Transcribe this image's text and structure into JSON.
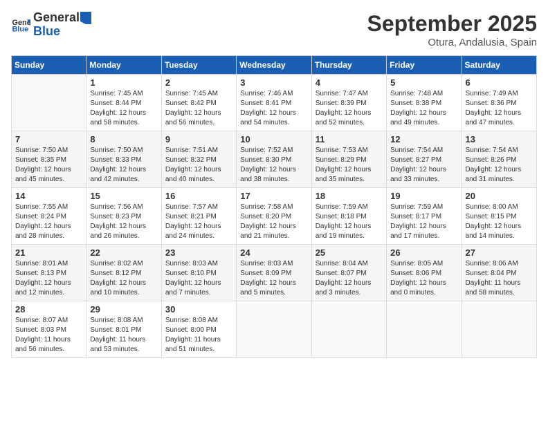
{
  "header": {
    "logo_line1": "General",
    "logo_line2": "Blue",
    "month": "September 2025",
    "location": "Otura, Andalusia, Spain"
  },
  "weekdays": [
    "Sunday",
    "Monday",
    "Tuesday",
    "Wednesday",
    "Thursday",
    "Friday",
    "Saturday"
  ],
  "weeks": [
    [
      {
        "day": "",
        "info": ""
      },
      {
        "day": "1",
        "info": "Sunrise: 7:45 AM\nSunset: 8:44 PM\nDaylight: 12 hours\nand 58 minutes."
      },
      {
        "day": "2",
        "info": "Sunrise: 7:45 AM\nSunset: 8:42 PM\nDaylight: 12 hours\nand 56 minutes."
      },
      {
        "day": "3",
        "info": "Sunrise: 7:46 AM\nSunset: 8:41 PM\nDaylight: 12 hours\nand 54 minutes."
      },
      {
        "day": "4",
        "info": "Sunrise: 7:47 AM\nSunset: 8:39 PM\nDaylight: 12 hours\nand 52 minutes."
      },
      {
        "day": "5",
        "info": "Sunrise: 7:48 AM\nSunset: 8:38 PM\nDaylight: 12 hours\nand 49 minutes."
      },
      {
        "day": "6",
        "info": "Sunrise: 7:49 AM\nSunset: 8:36 PM\nDaylight: 12 hours\nand 47 minutes."
      }
    ],
    [
      {
        "day": "7",
        "info": "Sunrise: 7:50 AM\nSunset: 8:35 PM\nDaylight: 12 hours\nand 45 minutes."
      },
      {
        "day": "8",
        "info": "Sunrise: 7:50 AM\nSunset: 8:33 PM\nDaylight: 12 hours\nand 42 minutes."
      },
      {
        "day": "9",
        "info": "Sunrise: 7:51 AM\nSunset: 8:32 PM\nDaylight: 12 hours\nand 40 minutes."
      },
      {
        "day": "10",
        "info": "Sunrise: 7:52 AM\nSunset: 8:30 PM\nDaylight: 12 hours\nand 38 minutes."
      },
      {
        "day": "11",
        "info": "Sunrise: 7:53 AM\nSunset: 8:29 PM\nDaylight: 12 hours\nand 35 minutes."
      },
      {
        "day": "12",
        "info": "Sunrise: 7:54 AM\nSunset: 8:27 PM\nDaylight: 12 hours\nand 33 minutes."
      },
      {
        "day": "13",
        "info": "Sunrise: 7:54 AM\nSunset: 8:26 PM\nDaylight: 12 hours\nand 31 minutes."
      }
    ],
    [
      {
        "day": "14",
        "info": "Sunrise: 7:55 AM\nSunset: 8:24 PM\nDaylight: 12 hours\nand 28 minutes."
      },
      {
        "day": "15",
        "info": "Sunrise: 7:56 AM\nSunset: 8:23 PM\nDaylight: 12 hours\nand 26 minutes."
      },
      {
        "day": "16",
        "info": "Sunrise: 7:57 AM\nSunset: 8:21 PM\nDaylight: 12 hours\nand 24 minutes."
      },
      {
        "day": "17",
        "info": "Sunrise: 7:58 AM\nSunset: 8:20 PM\nDaylight: 12 hours\nand 21 minutes."
      },
      {
        "day": "18",
        "info": "Sunrise: 7:59 AM\nSunset: 8:18 PM\nDaylight: 12 hours\nand 19 minutes."
      },
      {
        "day": "19",
        "info": "Sunrise: 7:59 AM\nSunset: 8:17 PM\nDaylight: 12 hours\nand 17 minutes."
      },
      {
        "day": "20",
        "info": "Sunrise: 8:00 AM\nSunset: 8:15 PM\nDaylight: 12 hours\nand 14 minutes."
      }
    ],
    [
      {
        "day": "21",
        "info": "Sunrise: 8:01 AM\nSunset: 8:13 PM\nDaylight: 12 hours\nand 12 minutes."
      },
      {
        "day": "22",
        "info": "Sunrise: 8:02 AM\nSunset: 8:12 PM\nDaylight: 12 hours\nand 10 minutes."
      },
      {
        "day": "23",
        "info": "Sunrise: 8:03 AM\nSunset: 8:10 PM\nDaylight: 12 hours\nand 7 minutes."
      },
      {
        "day": "24",
        "info": "Sunrise: 8:03 AM\nSunset: 8:09 PM\nDaylight: 12 hours\nand 5 minutes."
      },
      {
        "day": "25",
        "info": "Sunrise: 8:04 AM\nSunset: 8:07 PM\nDaylight: 12 hours\nand 3 minutes."
      },
      {
        "day": "26",
        "info": "Sunrise: 8:05 AM\nSunset: 8:06 PM\nDaylight: 12 hours\nand 0 minutes."
      },
      {
        "day": "27",
        "info": "Sunrise: 8:06 AM\nSunset: 8:04 PM\nDaylight: 11 hours\nand 58 minutes."
      }
    ],
    [
      {
        "day": "28",
        "info": "Sunrise: 8:07 AM\nSunset: 8:03 PM\nDaylight: 11 hours\nand 56 minutes."
      },
      {
        "day": "29",
        "info": "Sunrise: 8:08 AM\nSunset: 8:01 PM\nDaylight: 11 hours\nand 53 minutes."
      },
      {
        "day": "30",
        "info": "Sunrise: 8:08 AM\nSunset: 8:00 PM\nDaylight: 11 hours\nand 51 minutes."
      },
      {
        "day": "",
        "info": ""
      },
      {
        "day": "",
        "info": ""
      },
      {
        "day": "",
        "info": ""
      },
      {
        "day": "",
        "info": ""
      }
    ]
  ]
}
